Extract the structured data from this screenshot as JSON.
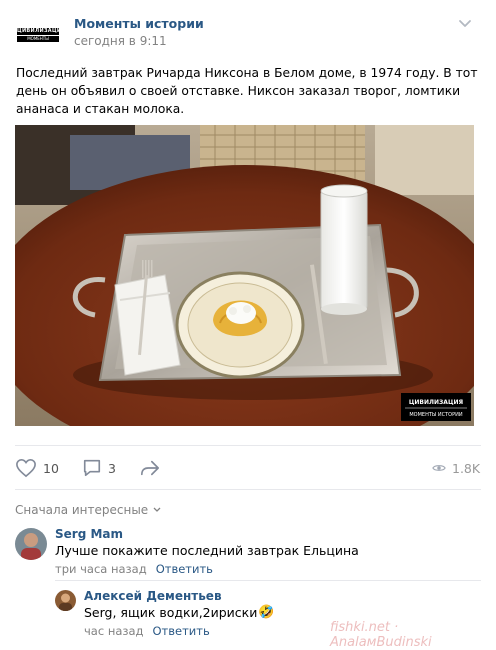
{
  "post": {
    "group_name": "Моменты истории",
    "time": "сегодня в 9:11",
    "logo_line1": "ЦИВИЛИЗАЦИЯ",
    "logo_line2": "МОМЕНТЫ ИСТОРИИ",
    "text": "Последний завтрак Ричарда Никсона в Белом доме, в 1974 году. В тот день он объявил о своей отставке. Никсон заказал творог, ломтики ананаса и стакан молока.",
    "photo_watermark_line1": "ЦИВИЛИЗАЦИЯ",
    "photo_watermark_line2": "МОМЕНТЫ ИСТОРИИ"
  },
  "actions": {
    "likes": "10",
    "comments": "3",
    "views": "1.8K"
  },
  "comments_section": {
    "sort_label": "Сначала интересные"
  },
  "comments": [
    {
      "author": "Serg Mam",
      "text": "Лучше покажите последний завтрак Ельцина",
      "time": "три часа назад",
      "reply_label": "Ответить"
    }
  ],
  "replies": [
    {
      "author": "Алексей Дементьев",
      "text": "Serg, ящик водки,2ириски",
      "emoji": "🤣",
      "time": "час назад",
      "reply_label": "Ответить"
    }
  ],
  "watermark": "fishki.net · AnalaмBudinski"
}
